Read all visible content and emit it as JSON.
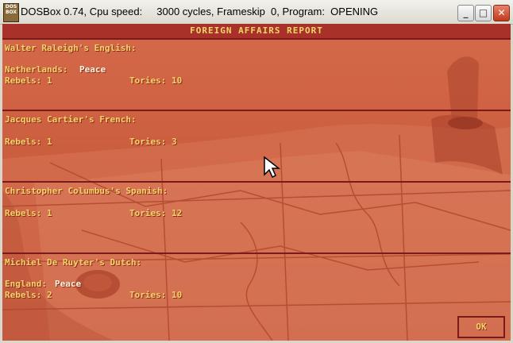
{
  "window": {
    "app_icon_text": "DOS BOX",
    "title": "DOSBox 0.74, Cpu speed:     3000 cycles, Frameskip  0, Program:  OPENING",
    "minimize_label": "_",
    "maximize_label": "□",
    "close_label": "✕"
  },
  "report": {
    "title": "FOREIGN AFFAIRS REPORT",
    "sections": [
      {
        "nation": "Walter Raleigh's English:",
        "relation_country": "Netherlands:",
        "relation_status": "Peace",
        "rebels": "Rebels: 1",
        "tories": "Tories: 10"
      },
      {
        "nation": "Jacques Cartier's French:",
        "rebels": "Rebels: 1",
        "tories": "Tories: 3"
      },
      {
        "nation": "Christopher Columbus's Spanish:",
        "rebels": "Rebels: 1",
        "tories": "Tories: 12"
      },
      {
        "nation": "Michiel De Ruyter's Dutch:",
        "relation_country": "England:",
        "relation_status": "Peace",
        "rebels": "Rebels: 2",
        "tories": "Tories: 10"
      }
    ],
    "ok_label": "OK"
  },
  "colors": {
    "background": "#c8593a",
    "header": "#a8322a",
    "text_yellow": "#f5d56a",
    "text_white": "#fff8e0",
    "divider": "#7a1a1a"
  }
}
